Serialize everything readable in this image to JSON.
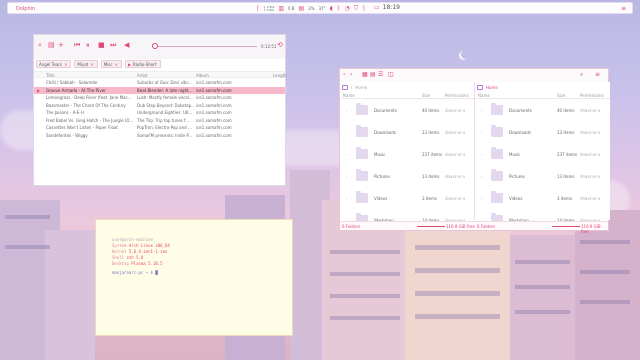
{
  "topbar": {
    "title": "Dolphin",
    "tray": {
      "net_down": "↓ 0 B/s",
      "net_up": "↑ 0 B/s",
      "mem": "0 B",
      "cpu": "2%",
      "temp": "37°"
    },
    "clock": "18:19"
  },
  "player": {
    "time": "0:12:51",
    "pills": [
      {
        "label": "Angel Tears"
      },
      {
        "label": "Miyat"
      },
      {
        "label": "Misc"
      },
      {
        "label": "Radio-Short"
      }
    ],
    "columns": [
      "Title",
      "Artist",
      "Album",
      "Length"
    ],
    "rows": [
      {
        "title": "Chilli / Sabbah - Salamder",
        "artist": "Suburbs of Goa: Desi vibr...",
        "album": "ice1.somafm.com",
        "selected": false
      },
      {
        "title": "Groove Armada - At The River",
        "artist": "Beat Blender: A late night...",
        "album": "ice1.somafm.com",
        "selected": true
      },
      {
        "title": "Lemongrass - Deep River (feat. Jane Mac...",
        "artist": "Lush: Mostly female vocal...",
        "album": "ice1.somafm.com",
        "selected": false
      },
      {
        "title": "Bassmaster - The Chant Of The Century",
        "artist": "Dub Step Beyond: Dubstep...",
        "album": "ice1.somafm.com",
        "selected": false
      },
      {
        "title": "The Jaisons - A-E-I-I",
        "artist": "Underground Eighties: UK...",
        "album": "ice1.somafm.com",
        "selected": false
      },
      {
        "title": "Fred Babel Vs. Greg Hatch - The Jungle (O...",
        "artist": "The Trip: Trip top tunes f...",
        "album": "ice1.somafm.com",
        "selected": false
      },
      {
        "title": "Cassettes Won't Listen - Paper Float",
        "artist": "PopTron: Electro-Pop and ...",
        "album": "ice1.somafm.com",
        "selected": false
      },
      {
        "title": "Sandeferites - Wiggy",
        "artist": "SomaFM presents: Indie P...",
        "album": "ice1.somafm.com",
        "selected": false
      }
    ]
  },
  "filemanager": {
    "left": {
      "crumb_root": "",
      "crumb_current": "Home",
      "columns": [
        "Name",
        "Size",
        "Permissions"
      ],
      "rows": [
        {
          "name": "Documents",
          "size": "40 items",
          "perm": "drwxr-xr-x"
        },
        {
          "name": "Downloads",
          "size": "13 items",
          "perm": "drwxr-xr-x"
        },
        {
          "name": "Music",
          "size": "237 items",
          "perm": "drwxr-xr-x"
        },
        {
          "name": "Pictures",
          "size": "13 items",
          "perm": "drwxr-xr-x"
        },
        {
          "name": "Videos",
          "size": "3 items",
          "perm": "drwxr-xr-x"
        },
        {
          "name": "Workshop",
          "size": "14 items",
          "perm": "drwxr-xr-x"
        }
      ],
      "status_folders": "6 Folders",
      "status_free": "116.9 GiB free"
    },
    "right": {
      "crumb_current": "Home",
      "columns": [
        "Name",
        "Size",
        "Permissions"
      ],
      "rows": [
        {
          "name": "Documents",
          "size": "40 items",
          "perm": "drwxr-xr-x"
        },
        {
          "name": "Downloads",
          "size": "13 items",
          "perm": "drwxr-xr-x"
        },
        {
          "name": "Music",
          "size": "237 items",
          "perm": "drwxr-xr-x"
        },
        {
          "name": "Pictures",
          "size": "13 items",
          "perm": "drwxr-xr-x"
        },
        {
          "name": "Videos",
          "size": "3 items",
          "perm": "drwxr-xr-x"
        },
        {
          "name": "Workshop",
          "size": "14 items",
          "perm": "drwxr-xr-x"
        }
      ],
      "status_folders": "6 Folders",
      "status_free": "116.9 GiB free"
    }
  },
  "terminal": {
    "userhost": "user@arch-machine",
    "lines": [
      {
        "key": "System",
        "value": "Arch Linux x86_64"
      },
      {
        "key": "Kernel",
        "value": "5.6.4-zen1-1-zen"
      },
      {
        "key": "Shell",
        "value": "zsh 5.8"
      },
      {
        "key": "Desktop",
        "value": "Plasma 5.18.5"
      }
    ],
    "prompt": "manjaroarc-pc ~ $"
  },
  "colors": {
    "accent": "#e04878",
    "selection": "#f6b9c9",
    "terminal_bg": "#fffde6"
  }
}
